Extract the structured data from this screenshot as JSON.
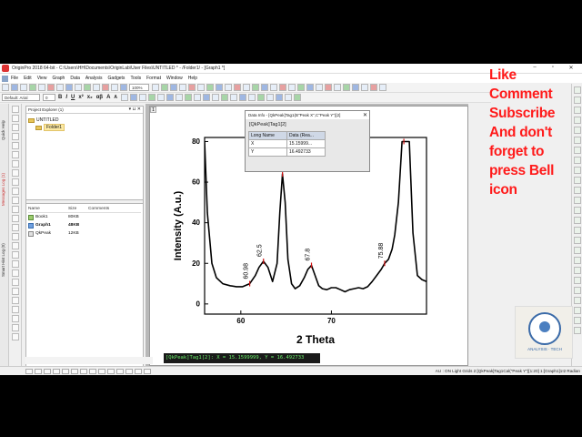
{
  "window": {
    "title": "OriginPro 2018 64-bit - C:\\Users\\HH\\Documents\\OriginLab\\User Files\\UNTITLED * - /Folder1/ - [Graph1 *]",
    "controls": [
      "–",
      "▫",
      "✕"
    ]
  },
  "menu": [
    "File",
    "Edit",
    "View",
    "Graph",
    "Data",
    "Analysis",
    "Gadgets",
    "Tools",
    "Format",
    "Window",
    "Help"
  ],
  "toolbar": {
    "zoom": "100%",
    "font_name": "Default: Arial",
    "font_size": "0",
    "format_letters": [
      "B",
      "I",
      "U",
      "x²",
      "x₂",
      "αβ",
      "A",
      "A"
    ]
  },
  "vertical_tabs": [
    "Quick Help",
    "Messages Log (1)",
    "Smart Hint Log (0)"
  ],
  "project_explorer": {
    "title": "Project Explorer (1)",
    "controls": "▾ ⊔ ✕",
    "tree": {
      "root": "UNTITLED",
      "child": "Folder1"
    },
    "columns": [
      "Name",
      "Size",
      "Comments"
    ],
    "items": [
      {
        "name": "Book1",
        "size": "80KB",
        "comments": "",
        "type": "book"
      },
      {
        "name": "Graph1",
        "size": "48KB",
        "comments": "",
        "type": "graph"
      },
      {
        "name": "QkPeak",
        "size": "12KB",
        "comments": "",
        "type": "qk"
      }
    ]
  },
  "graph_window": {
    "layer_tag": "1"
  },
  "data_info": {
    "title": "Data Info - [QkPeak]Tag1(B\"Peak X\",C\"Peak Y\")[2]",
    "close": "✕",
    "tag": "[QkPeak]Tag1[2]",
    "headers": [
      "Long Name",
      "Data (Rea..."
    ],
    "rows": [
      {
        "name": "X",
        "value": "15.15999..."
      },
      {
        "name": "Y",
        "value": "16.492733"
      }
    ]
  },
  "readout": "[QkPeak]Tag1[2]:  X = 15.1599999, Y = 16.492733",
  "overlay": {
    "lines": [
      "Like",
      "Comment",
      "Subscribe",
      "And don't",
      "forget to",
      "press Bell",
      "icon"
    ],
    "color": "#ff1a1a"
  },
  "logo": {
    "caption": "ANALYSIS · TECH"
  },
  "statusbar": {
    "right": "AU : ON  Light Grids  2:[QkPeak]Tag1Cal(\"Peak Y\")[1:20]  1:[Graph1]1!2  Radian"
  },
  "chart_data": {
    "type": "line",
    "xlabel": "2 Theta",
    "ylabel": "Intensity (A.u.)",
    "xlim": [
      56,
      80.5
    ],
    "ylim": [
      -5,
      82
    ],
    "xticks": [
      60,
      70
    ],
    "yticks": [
      0,
      20,
      40,
      60,
      80
    ],
    "series": [
      {
        "x": [
          56.0,
          56.3,
          56.8,
          57.3,
          58.0,
          58.8,
          59.5,
          60.2,
          60.98,
          61.6,
          62.0,
          62.5,
          63.0,
          63.5,
          64.0,
          64.3,
          64.6,
          64.9,
          65.2,
          65.6,
          66.0,
          66.5,
          67.0,
          67.4,
          67.8,
          68.2,
          68.6,
          69.0,
          69.5,
          70.0,
          70.5,
          71.0,
          71.5,
          72.0,
          72.5,
          73.0,
          73.5,
          74.0,
          74.5,
          75.0,
          75.5,
          75.88,
          76.3,
          76.7,
          77.0,
          77.4,
          77.8,
          78.2,
          78.6,
          79.0,
          79.5,
          80.0,
          80.5
        ],
        "y": [
          80,
          45,
          20,
          13,
          10,
          9,
          8.5,
          8.5,
          10,
          14,
          18,
          21,
          18,
          11,
          20,
          45,
          64,
          50,
          22,
          10,
          7.5,
          9,
          13,
          17,
          19,
          14,
          9,
          7.5,
          7,
          8,
          8,
          7,
          6,
          7,
          7.5,
          8,
          7.5,
          8.5,
          11,
          14,
          17,
          20,
          22,
          27,
          34,
          50,
          80,
          80,
          80,
          35,
          14,
          12,
          11
        ]
      }
    ],
    "annotations": [
      {
        "label": "60.98",
        "x": 60.98,
        "y": 10
      },
      {
        "label": "62.5",
        "x": 62.5,
        "y": 21
      },
      {
        "label": "67.8",
        "x": 67.8,
        "y": 19
      },
      {
        "label": "75.88",
        "x": 75.88,
        "y": 20
      }
    ],
    "peak_markers": [
      {
        "x": 60.98,
        "y": 10
      },
      {
        "x": 62.5,
        "y": 21
      },
      {
        "x": 64.6,
        "y": 64
      },
      {
        "x": 67.8,
        "y": 19
      },
      {
        "x": 75.88,
        "y": 20
      },
      {
        "x": 78.0,
        "y": 80
      }
    ]
  }
}
